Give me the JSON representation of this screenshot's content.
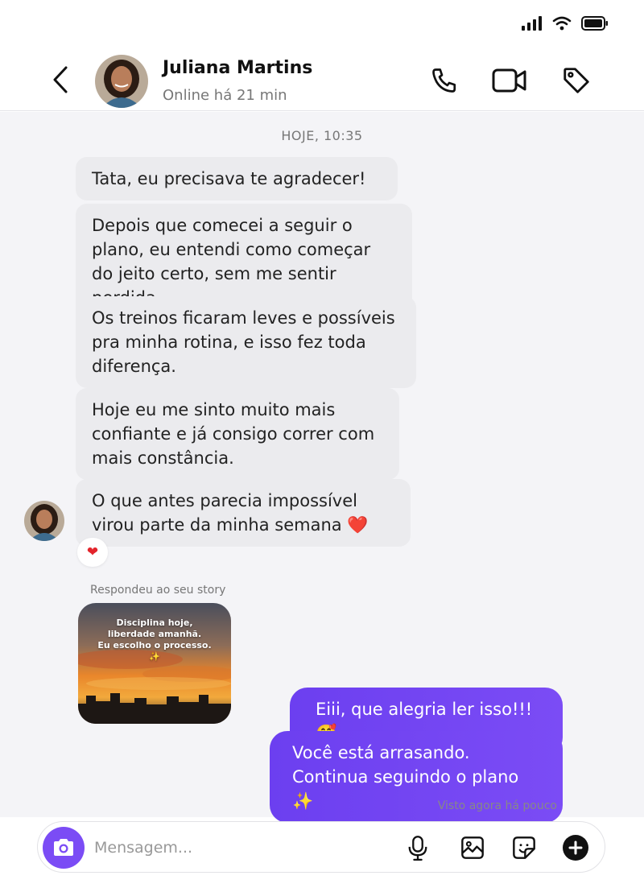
{
  "contact": {
    "name": "Juliana Martins",
    "status": "Online há 21 min"
  },
  "header_icons": [
    "back-icon",
    "phone-icon",
    "video-icon",
    "tag-icon"
  ],
  "status_icons": [
    "signal-icon",
    "wifi-icon",
    "battery-icon"
  ],
  "chat": {
    "timestamp": "HOJE, 10:35",
    "incoming": [
      {
        "text": "Tata, eu precisava te agradecer!"
      },
      {
        "text": "Depois que comecei a seguir o plano, eu entendi como começar do jeito certo, sem me sentir perdida."
      },
      {
        "text": "Os treinos ficaram leves e possíveis pra minha rotina, e isso fez toda diferença."
      },
      {
        "text": "Hoje eu me sinto muito mais confiante e já consigo correr com mais constância."
      },
      {
        "text": "O que antes parecia impossível virou parte da minha semana ❤️"
      }
    ],
    "reaction": "❤",
    "story": {
      "label": "Respondeu ao seu story",
      "text": "Disciplina hoje,\nliberdade amanhã.\nEu escolho o processo.\n✨"
    },
    "outgoing": [
      {
        "text": "Eiii, que alegria ler isso!!! 🥰"
      },
      {
        "text": "Você está arrasando. Continua seguindo o plano ✨"
      }
    ],
    "seen": "Visto agora há pouco"
  },
  "composer": {
    "placeholder": "Mensagem...",
    "icons": [
      "camera-icon",
      "microphone-icon",
      "gallery-icon",
      "sticker-icon",
      "plus-icon"
    ]
  },
  "colors": {
    "accent": "#7b4cf5",
    "incoming_bubble": "#ebebee",
    "chat_background": "#f4f4f7"
  }
}
